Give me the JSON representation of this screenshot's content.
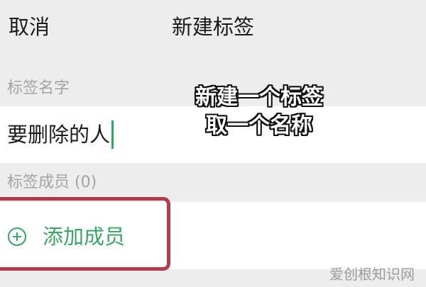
{
  "header": {
    "cancel_label": "取消",
    "title": "新建标签"
  },
  "tag_name_section": {
    "label": "标签名字",
    "input_value": "要删除的人"
  },
  "members_section": {
    "label": "标签成员 (0)",
    "add_member_label": "添加成员"
  },
  "overlay_caption": {
    "line1": "新建一个标签",
    "line2": "取一个名称"
  },
  "watermark": "爱创根知识网",
  "colors": {
    "accent_green": "#39a764",
    "caret_green": "#20b24f",
    "highlight_red": "#b53a4b",
    "background": "#ededed"
  },
  "icons": {
    "add_member_icon": "plus-circle-icon"
  }
}
